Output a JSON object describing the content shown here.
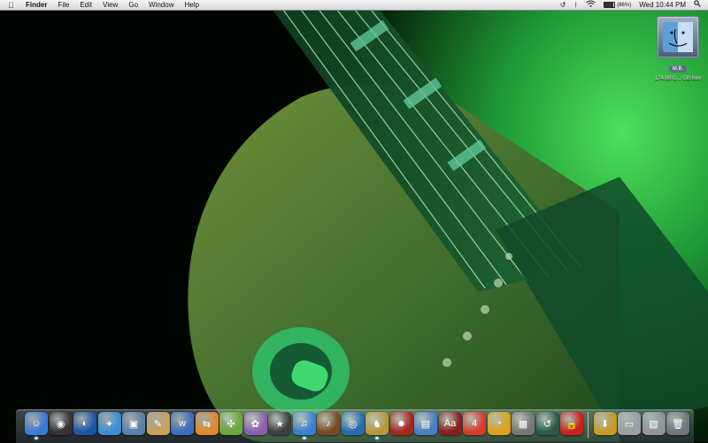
{
  "menubar": {
    "apple_icon": "apple-logo-icon",
    "app_name": "Finder",
    "menus": [
      "File",
      "Edit",
      "View",
      "Go",
      "Window",
      "Help"
    ],
    "status": {
      "time_machine_icon": "time-machine-icon",
      "bluetooth_icon": "bluetooth-icon",
      "wifi_icon": "wifi-icon",
      "battery_icon": "battery-icon",
      "battery_percent_label": "(86%)",
      "battery_level": 0.86,
      "clock": "Wed 10:44 PM",
      "spotlight_icon": "spotlight-icon"
    }
  },
  "desktop": {
    "disk": {
      "icon": "hard-disk-icon",
      "label": "M.B.",
      "free_space": "174.88 G... GB free"
    }
  },
  "dock": {
    "items": [
      {
        "name": "dock-finder",
        "icon": "finder-icon",
        "glyph": "☺",
        "color": "#3a7bd5"
      },
      {
        "name": "dock-dashboard",
        "icon": "dashboard-icon",
        "glyph": "◉",
        "color": "#333"
      },
      {
        "name": "dock-google-earth",
        "icon": "globe-icon",
        "glyph": "◐",
        "color": "#1d56a8"
      },
      {
        "name": "dock-safari",
        "icon": "compass-icon",
        "glyph": "✦",
        "color": "#3b8fd6"
      },
      {
        "name": "dock-preview",
        "icon": "preview-icon",
        "glyph": "▣",
        "color": "#5a7fa8"
      },
      {
        "name": "dock-notes",
        "icon": "notepad-icon",
        "glyph": "✎",
        "color": "#c9a35a"
      },
      {
        "name": "dock-app-w",
        "icon": "w-app-icon",
        "glyph": "w",
        "color": "#3a6fbf"
      },
      {
        "name": "dock-ftp",
        "icon": "transmit-icon",
        "glyph": "⇆",
        "color": "#e08a2c"
      },
      {
        "name": "dock-network",
        "icon": "network-icon",
        "glyph": "✣",
        "color": "#6aa83a"
      },
      {
        "name": "dock-tool",
        "icon": "puzzle-icon",
        "glyph": "✿",
        "color": "#8a5fb0"
      },
      {
        "name": "dock-star-app",
        "icon": "star-icon",
        "glyph": "★",
        "color": "#3d3d3d"
      },
      {
        "name": "dock-itunes",
        "icon": "music-note-icon",
        "glyph": "♫",
        "color": "#3b7fd0"
      },
      {
        "name": "dock-garageband",
        "icon": "guitar-icon",
        "glyph": "♪",
        "color": "#7a4a22"
      },
      {
        "name": "dock-photo-booth",
        "icon": "camera-icon",
        "glyph": "◎",
        "color": "#2a6cb0"
      },
      {
        "name": "dock-chess",
        "icon": "chess-board-icon",
        "glyph": "♞",
        "color": "#b89a3a"
      },
      {
        "name": "dock-game",
        "icon": "game-icon",
        "glyph": "✹",
        "color": "#a8261f"
      },
      {
        "name": "dock-web-app",
        "icon": "browser-window-icon",
        "glyph": "▤",
        "color": "#4a7fc0"
      },
      {
        "name": "dock-dictionary",
        "icon": "dictionary-icon",
        "glyph": "Aa",
        "color": "#8a1e1e"
      },
      {
        "name": "dock-ical",
        "icon": "calendar-icon",
        "glyph": "4",
        "color": "#d83a2e"
      },
      {
        "name": "dock-timer",
        "icon": "stopwatch-icon",
        "glyph": "◔",
        "color": "#e0a21a"
      },
      {
        "name": "dock-utility",
        "icon": "utility-icon",
        "glyph": "▦",
        "color": "#777"
      },
      {
        "name": "dock-time-machine",
        "icon": "time-machine-icon",
        "glyph": "↺",
        "color": "#2a5b4a"
      },
      {
        "name": "dock-keychain",
        "icon": "padlock-icon",
        "glyph": "🔒",
        "color": "#c8211e"
      },
      {
        "name": "dock-downloads",
        "icon": "downloads-folder-icon",
        "glyph": "⬇",
        "color": "#c79a2a"
      },
      {
        "name": "dock-documents",
        "icon": "documents-folder-icon",
        "glyph": "▭",
        "color": "#9aa0a6"
      },
      {
        "name": "dock-pictures",
        "icon": "pictures-folder-icon",
        "glyph": "▧",
        "color": "#8f969c"
      },
      {
        "name": "dock-trash",
        "icon": "trash-icon",
        "glyph": "🗑",
        "color": "#6f7780"
      }
    ],
    "running": [
      "dock-finder",
      "dock-itunes",
      "dock-chess"
    ]
  }
}
